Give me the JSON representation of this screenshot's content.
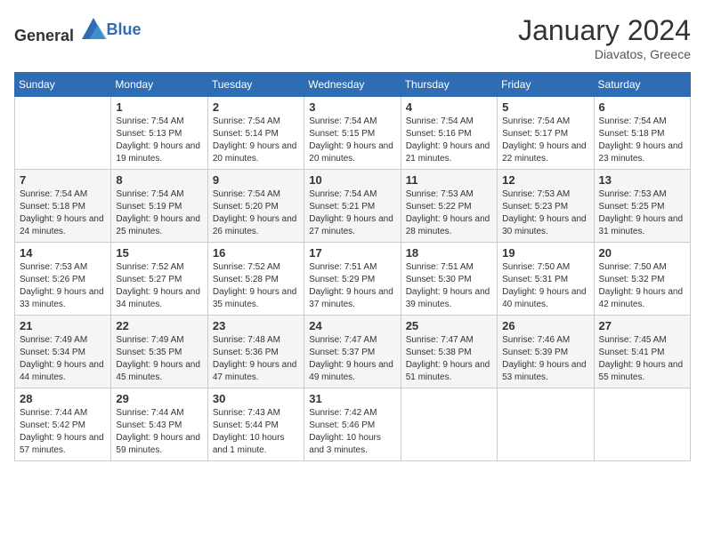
{
  "header": {
    "logo_general": "General",
    "logo_blue": "Blue",
    "month_year": "January 2024",
    "location": "Diavatos, Greece"
  },
  "days_of_week": [
    "Sunday",
    "Monday",
    "Tuesday",
    "Wednesday",
    "Thursday",
    "Friday",
    "Saturday"
  ],
  "weeks": [
    [
      {
        "day": "",
        "sunrise": "",
        "sunset": "",
        "daylight": ""
      },
      {
        "day": "1",
        "sunrise": "Sunrise: 7:54 AM",
        "sunset": "Sunset: 5:13 PM",
        "daylight": "Daylight: 9 hours and 19 minutes."
      },
      {
        "day": "2",
        "sunrise": "Sunrise: 7:54 AM",
        "sunset": "Sunset: 5:14 PM",
        "daylight": "Daylight: 9 hours and 20 minutes."
      },
      {
        "day": "3",
        "sunrise": "Sunrise: 7:54 AM",
        "sunset": "Sunset: 5:15 PM",
        "daylight": "Daylight: 9 hours and 20 minutes."
      },
      {
        "day": "4",
        "sunrise": "Sunrise: 7:54 AM",
        "sunset": "Sunset: 5:16 PM",
        "daylight": "Daylight: 9 hours and 21 minutes."
      },
      {
        "day": "5",
        "sunrise": "Sunrise: 7:54 AM",
        "sunset": "Sunset: 5:17 PM",
        "daylight": "Daylight: 9 hours and 22 minutes."
      },
      {
        "day": "6",
        "sunrise": "Sunrise: 7:54 AM",
        "sunset": "Sunset: 5:18 PM",
        "daylight": "Daylight: 9 hours and 23 minutes."
      }
    ],
    [
      {
        "day": "7",
        "sunrise": "Sunrise: 7:54 AM",
        "sunset": "Sunset: 5:18 PM",
        "daylight": "Daylight: 9 hours and 24 minutes."
      },
      {
        "day": "8",
        "sunrise": "Sunrise: 7:54 AM",
        "sunset": "Sunset: 5:19 PM",
        "daylight": "Daylight: 9 hours and 25 minutes."
      },
      {
        "day": "9",
        "sunrise": "Sunrise: 7:54 AM",
        "sunset": "Sunset: 5:20 PM",
        "daylight": "Daylight: 9 hours and 26 minutes."
      },
      {
        "day": "10",
        "sunrise": "Sunrise: 7:54 AM",
        "sunset": "Sunset: 5:21 PM",
        "daylight": "Daylight: 9 hours and 27 minutes."
      },
      {
        "day": "11",
        "sunrise": "Sunrise: 7:53 AM",
        "sunset": "Sunset: 5:22 PM",
        "daylight": "Daylight: 9 hours and 28 minutes."
      },
      {
        "day": "12",
        "sunrise": "Sunrise: 7:53 AM",
        "sunset": "Sunset: 5:23 PM",
        "daylight": "Daylight: 9 hours and 30 minutes."
      },
      {
        "day": "13",
        "sunrise": "Sunrise: 7:53 AM",
        "sunset": "Sunset: 5:25 PM",
        "daylight": "Daylight: 9 hours and 31 minutes."
      }
    ],
    [
      {
        "day": "14",
        "sunrise": "Sunrise: 7:53 AM",
        "sunset": "Sunset: 5:26 PM",
        "daylight": "Daylight: 9 hours and 33 minutes."
      },
      {
        "day": "15",
        "sunrise": "Sunrise: 7:52 AM",
        "sunset": "Sunset: 5:27 PM",
        "daylight": "Daylight: 9 hours and 34 minutes."
      },
      {
        "day": "16",
        "sunrise": "Sunrise: 7:52 AM",
        "sunset": "Sunset: 5:28 PM",
        "daylight": "Daylight: 9 hours and 35 minutes."
      },
      {
        "day": "17",
        "sunrise": "Sunrise: 7:51 AM",
        "sunset": "Sunset: 5:29 PM",
        "daylight": "Daylight: 9 hours and 37 minutes."
      },
      {
        "day": "18",
        "sunrise": "Sunrise: 7:51 AM",
        "sunset": "Sunset: 5:30 PM",
        "daylight": "Daylight: 9 hours and 39 minutes."
      },
      {
        "day": "19",
        "sunrise": "Sunrise: 7:50 AM",
        "sunset": "Sunset: 5:31 PM",
        "daylight": "Daylight: 9 hours and 40 minutes."
      },
      {
        "day": "20",
        "sunrise": "Sunrise: 7:50 AM",
        "sunset": "Sunset: 5:32 PM",
        "daylight": "Daylight: 9 hours and 42 minutes."
      }
    ],
    [
      {
        "day": "21",
        "sunrise": "Sunrise: 7:49 AM",
        "sunset": "Sunset: 5:34 PM",
        "daylight": "Daylight: 9 hours and 44 minutes."
      },
      {
        "day": "22",
        "sunrise": "Sunrise: 7:49 AM",
        "sunset": "Sunset: 5:35 PM",
        "daylight": "Daylight: 9 hours and 45 minutes."
      },
      {
        "day": "23",
        "sunrise": "Sunrise: 7:48 AM",
        "sunset": "Sunset: 5:36 PM",
        "daylight": "Daylight: 9 hours and 47 minutes."
      },
      {
        "day": "24",
        "sunrise": "Sunrise: 7:47 AM",
        "sunset": "Sunset: 5:37 PM",
        "daylight": "Daylight: 9 hours and 49 minutes."
      },
      {
        "day": "25",
        "sunrise": "Sunrise: 7:47 AM",
        "sunset": "Sunset: 5:38 PM",
        "daylight": "Daylight: 9 hours and 51 minutes."
      },
      {
        "day": "26",
        "sunrise": "Sunrise: 7:46 AM",
        "sunset": "Sunset: 5:39 PM",
        "daylight": "Daylight: 9 hours and 53 minutes."
      },
      {
        "day": "27",
        "sunrise": "Sunrise: 7:45 AM",
        "sunset": "Sunset: 5:41 PM",
        "daylight": "Daylight: 9 hours and 55 minutes."
      }
    ],
    [
      {
        "day": "28",
        "sunrise": "Sunrise: 7:44 AM",
        "sunset": "Sunset: 5:42 PM",
        "daylight": "Daylight: 9 hours and 57 minutes."
      },
      {
        "day": "29",
        "sunrise": "Sunrise: 7:44 AM",
        "sunset": "Sunset: 5:43 PM",
        "daylight": "Daylight: 9 hours and 59 minutes."
      },
      {
        "day": "30",
        "sunrise": "Sunrise: 7:43 AM",
        "sunset": "Sunset: 5:44 PM",
        "daylight": "Daylight: 10 hours and 1 minute."
      },
      {
        "day": "31",
        "sunrise": "Sunrise: 7:42 AM",
        "sunset": "Sunset: 5:46 PM",
        "daylight": "Daylight: 10 hours and 3 minutes."
      },
      {
        "day": "",
        "sunrise": "",
        "sunset": "",
        "daylight": ""
      },
      {
        "day": "",
        "sunrise": "",
        "sunset": "",
        "daylight": ""
      },
      {
        "day": "",
        "sunrise": "",
        "sunset": "",
        "daylight": ""
      }
    ]
  ]
}
